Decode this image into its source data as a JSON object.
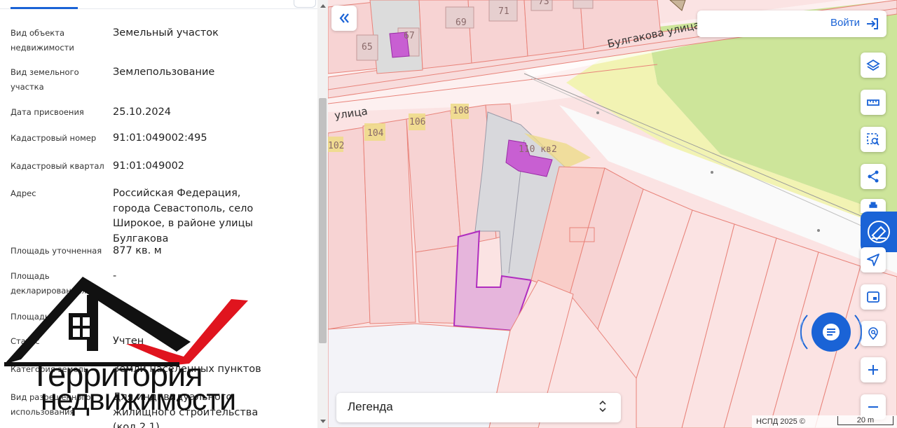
{
  "panel": {
    "rows": [
      {
        "label": "Вид объекта недвижимости",
        "value": "Земельный участок"
      },
      {
        "label": "Вид земельного участка",
        "value": "Землепользование"
      },
      {
        "label": "Дата присвоения",
        "value": "25.10.2024"
      },
      {
        "label": "Кадастровый номер",
        "value": "91:01:049002:495"
      },
      {
        "label": "Кадастровый квартал",
        "value": "91:01:049002"
      },
      {
        "label": "Адрес",
        "value": "Российская Федерация, города Севастополь, село Широкое, в районе улицы Булгакова"
      },
      {
        "label": "Площадь уточненная",
        "value": "877 кв. м"
      },
      {
        "label": "Площадь декларированная",
        "value": "-"
      },
      {
        "label": "Площадь",
        "value": ""
      },
      {
        "label": "Статус",
        "value": "Учтен"
      },
      {
        "label": "Категория земель",
        "value": "Земли населенных пунктов"
      },
      {
        "label": "Вид разрешенного использования",
        "value": "Для индивидуального жилищного строительства (код 2.1)"
      }
    ]
  },
  "logo": {
    "line1": "Территория",
    "line2": "недвижимости",
    "colors": {
      "dark": "#111111",
      "accent": "#e0141e"
    }
  },
  "map": {
    "street_labels": [
      "Булгакова улица",
      "улица"
    ],
    "house_numbers": [
      "65",
      "67",
      "69",
      "71",
      "73",
      "102",
      "104",
      "106",
      "108",
      "110 кв2"
    ],
    "login_label": "Войти",
    "legend_label": "Легенда",
    "attribution": "НСПД 2025 ©",
    "scale_label": "20 m",
    "controls": [
      "layers-icon",
      "ruler-icon",
      "select-area-icon",
      "share-icon",
      "print-icon",
      "locate-icon",
      "minimap-icon",
      "search-location-icon",
      "zoom-in-icon",
      "zoom-out-icon"
    ],
    "colors": {
      "accent": "#1a63d6",
      "parcel": "#f7d3d3",
      "parcel_line": "#e8837a",
      "selected": "#b02dbf",
      "green": "#cde59a",
      "yellow": "#f2f3b3"
    }
  }
}
